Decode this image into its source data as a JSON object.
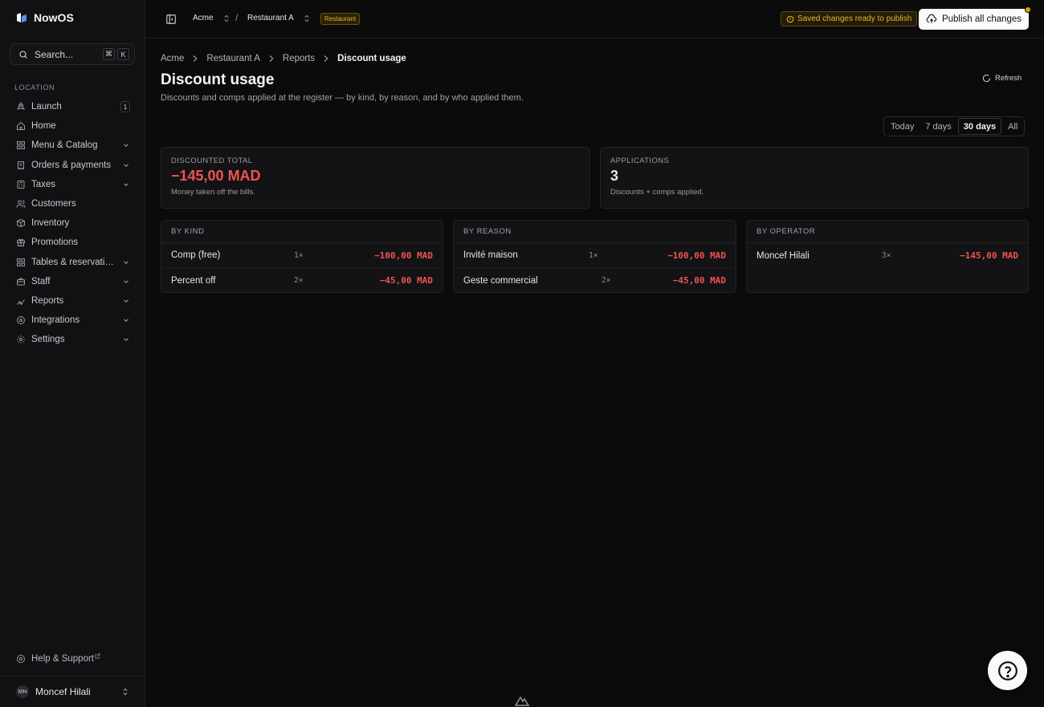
{
  "app": {
    "name": "NowOS"
  },
  "search": {
    "label": "Search...",
    "kbd1": "⌘",
    "kbd2": "K"
  },
  "sidebar": {
    "section": "LOCATION",
    "items": [
      {
        "label": "Launch",
        "icon": "rocket-icon",
        "badge": "1"
      },
      {
        "label": "Home",
        "icon": "home-icon"
      },
      {
        "label": "Menu & Catalog",
        "icon": "grid-icon",
        "expandable": true
      },
      {
        "label": "Orders & payments",
        "icon": "receipt-icon",
        "expandable": true
      },
      {
        "label": "Taxes",
        "icon": "calculator-icon",
        "expandable": true
      },
      {
        "label": "Customers",
        "icon": "users-icon"
      },
      {
        "label": "Inventory",
        "icon": "box-icon"
      },
      {
        "label": "Promotions",
        "icon": "gift-icon"
      },
      {
        "label": "Tables & reservations",
        "icon": "table-icon",
        "expandable": true
      },
      {
        "label": "Staff",
        "icon": "briefcase-icon",
        "expandable": true
      },
      {
        "label": "Reports",
        "icon": "chart-icon",
        "expandable": true
      },
      {
        "label": "Integrations",
        "icon": "plug-icon",
        "expandable": true
      },
      {
        "label": "Settings",
        "icon": "gear-icon",
        "expandable": true
      }
    ],
    "help": "Help & Support",
    "user": {
      "initials": "MH",
      "name": "Moncef Hilali"
    }
  },
  "topbar": {
    "org": "Acme",
    "separator": "/",
    "location": "Restaurant A",
    "location_tag": "Restaurant",
    "saved_notice": "Saved changes ready to publish",
    "publish_label": "Publish all changes"
  },
  "breadcrumb": [
    "Acme",
    "Restaurant A",
    "Reports",
    "Discount usage"
  ],
  "page": {
    "title": "Discount usage",
    "subtitle": "Discounts and comps applied at the register — by kind, by reason, and by who applied them.",
    "refresh_label": "Refresh"
  },
  "range_tabs": [
    "Today",
    "7 days",
    "30 days",
    "All"
  ],
  "range_selected": "30 days",
  "kpis": {
    "discounted_total": {
      "label": "DISCOUNTED TOTAL",
      "value": "−145,00 MAD",
      "sub": "Money taken off the bills."
    },
    "applications": {
      "label": "APPLICATIONS",
      "value": "3",
      "sub": "Discounts + comps applied."
    }
  },
  "by_kind": {
    "title": "BY KIND",
    "rows": [
      {
        "name": "Comp (free)",
        "count": "1×",
        "amount": "−100,00 MAD"
      },
      {
        "name": "Percent off",
        "count": "2×",
        "amount": "−45,00 MAD"
      }
    ]
  },
  "by_reason": {
    "title": "BY REASON",
    "rows": [
      {
        "name": "Invité maison",
        "count": "1×",
        "amount": "−100,00 MAD"
      },
      {
        "name": "Geste commercial",
        "count": "2×",
        "amount": "−45,00 MAD"
      }
    ]
  },
  "by_operator": {
    "title": "BY OPERATOR",
    "rows": [
      {
        "name": "Moncef Hilali",
        "count": "3×",
        "amount": "−145,00 MAD"
      }
    ]
  },
  "colors": {
    "negative": "#ef5350",
    "warning": "#e9b52f",
    "background": "#0b0b0c"
  }
}
